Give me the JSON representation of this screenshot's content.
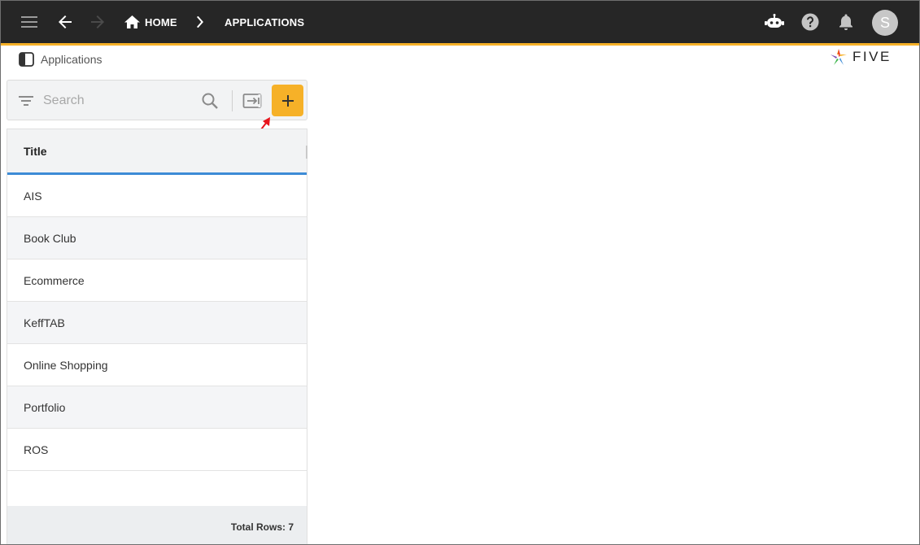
{
  "header": {
    "breadcrumbs": [
      {
        "label": "HOME",
        "icon": "home-icon"
      },
      {
        "label": "APPLICATIONS"
      }
    ],
    "icons": [
      "menu-icon",
      "back-arrow-icon",
      "forward-arrow-icon",
      "chatbot-icon",
      "help-icon",
      "bell-icon"
    ],
    "avatar_initial": "S",
    "accent_color": "#f6b128",
    "bar_color": "#262626"
  },
  "page": {
    "title": "Applications",
    "logo_text": "FIVE"
  },
  "search": {
    "placeholder": "Search",
    "value": ""
  },
  "list": {
    "column_header": "Title",
    "rows": [
      "AIS",
      "Book Club",
      "Ecommerce",
      "KeffTAB",
      "Online Shopping",
      "Portfolio",
      "ROS"
    ],
    "footer_total": "Total Rows: 7"
  },
  "colors": {
    "add_button": "#f6b128",
    "header_underline": "#3d8bd6",
    "annotation_arrow": "#e8141c"
  }
}
